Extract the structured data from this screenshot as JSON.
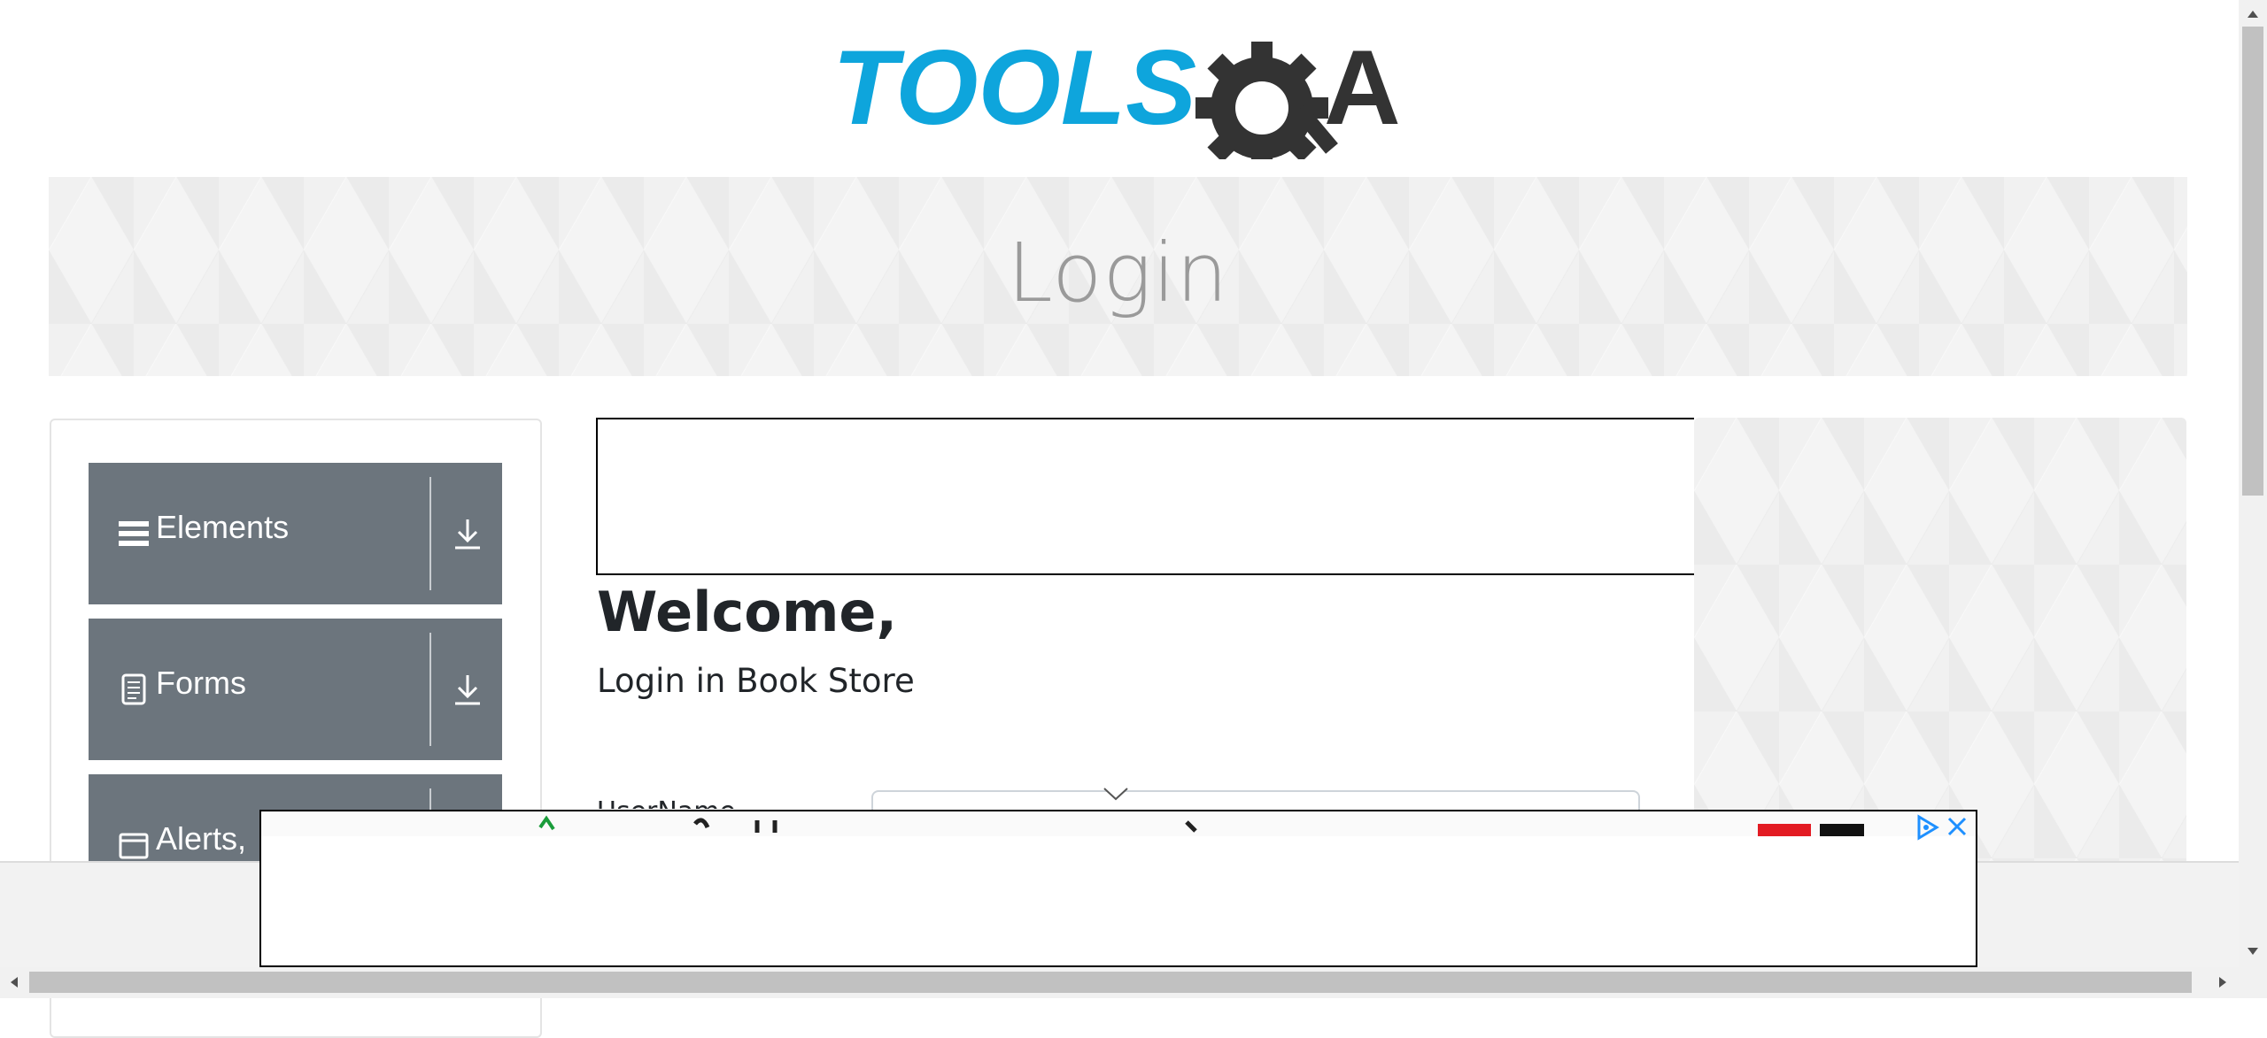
{
  "header": {
    "logo_text_left": "TOOLS",
    "logo_text_right": "A",
    "logo_colors": {
      "tools": "#0ea5dc",
      "qa": "#333333"
    }
  },
  "banner": {
    "title": "Login"
  },
  "sidebar": {
    "groups": [
      {
        "label": "Elements",
        "icon": "hamburger-icon"
      },
      {
        "label": "Forms",
        "icon": "document-icon"
      },
      {
        "label": "Alerts,",
        "icon": "window-icon"
      }
    ],
    "header_color": "#6c757d"
  },
  "main": {
    "welcome": "Welcome,",
    "subtitle": "Login in Book Store",
    "username_label": "UserName"
  },
  "ads": {
    "close_icon": "close-icon",
    "adchoices_icon": "adchoices-icon"
  }
}
